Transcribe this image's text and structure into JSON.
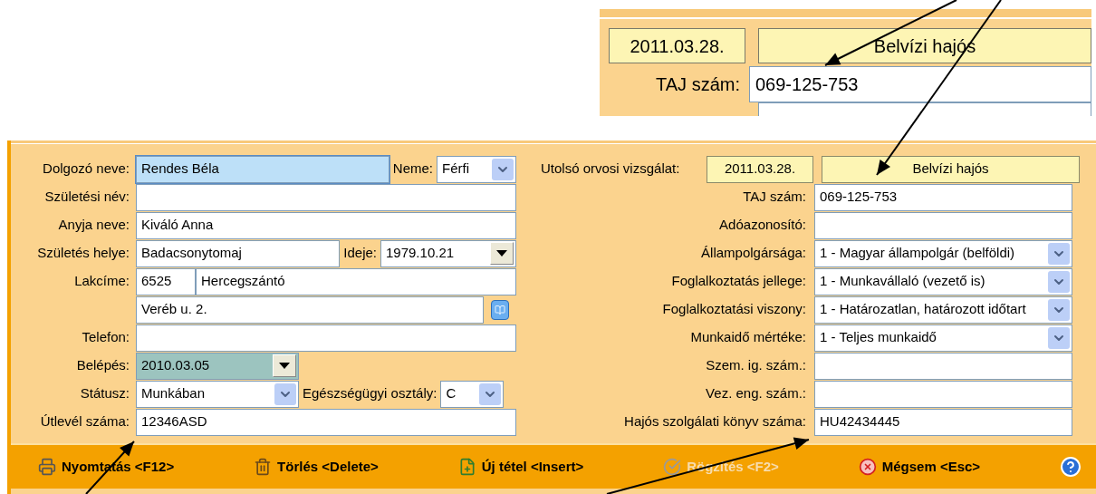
{
  "inset": {
    "date": "2011.03.28.",
    "category": "Belvízi hajós",
    "taj_label": "TAJ szám:",
    "taj_value": "069-125-753"
  },
  "left_rows": [
    {
      "label": "Dolgozó neve:",
      "fields": [
        {
          "kind": "text",
          "value": "Rendes Béla",
          "focused": true,
          "selected": false
        },
        {
          "kind": "select",
          "label": "Neme:",
          "value": "Férfi",
          "focused": false,
          "selected": false
        }
      ]
    },
    {
      "label": "Születési név:",
      "fields": [
        {
          "kind": "text",
          "focused": false,
          "selected": false
        }
      ]
    },
    {
      "label": "Anyja neve:",
      "fields": [
        {
          "kind": "text",
          "value": "Kiváló Anna",
          "focused": false,
          "selected": false
        }
      ]
    },
    {
      "label": "Születés helye:",
      "fields": [
        {
          "kind": "text",
          "value": "Badacsonytomaj",
          "focused": false,
          "selected": false
        },
        {
          "kind": "date",
          "label": "Ideje:",
          "value": "1979.10.21",
          "focused": false,
          "selected": false
        }
      ]
    },
    {
      "label": "Lakcíme:",
      "fields": [
        {
          "kind": "text",
          "value": "6525",
          "focused": false,
          "selected": false
        },
        {
          "kind": "text",
          "value": "Hercegszántó",
          "focused": false,
          "selected": false
        }
      ]
    },
    {
      "fields": [
        {
          "kind": "text",
          "value": "Veréb u. 2.",
          "focused": false,
          "selected": false
        },
        {
          "kind": "icon_button"
        }
      ]
    },
    {
      "label": "Telefon:",
      "fields": [
        {
          "kind": "text",
          "focused": false,
          "selected": false
        }
      ]
    },
    {
      "label": "Belépés:",
      "fields": [
        {
          "kind": "date",
          "value": "2010.03.05",
          "focused": false,
          "selected": true
        }
      ]
    },
    {
      "label": "Státusz:",
      "fields": [
        {
          "kind": "select",
          "value": "Munkában",
          "focused": false,
          "selected": false
        },
        {
          "kind": "select",
          "label": "Egészségügyi osztály:",
          "value": "C",
          "focused": false,
          "selected": false
        }
      ]
    },
    {
      "label": "Útlevél száma:",
      "fields": [
        {
          "kind": "text",
          "value": "12346ASD",
          "focused": false,
          "selected": false
        }
      ]
    }
  ],
  "right_rows": [
    {
      "label": "Utolsó orvosi vizsgálat:",
      "fields": [
        {
          "kind": "badge",
          "value": "2011.03.28."
        },
        {
          "kind": "badge",
          "value": "Belvízi hajós"
        }
      ]
    },
    {
      "label": "TAJ szám:",
      "fields": [
        {
          "kind": "text",
          "value": "069-125-753"
        }
      ]
    },
    {
      "label": "Adóazonosító:",
      "fields": [
        {
          "kind": "text"
        }
      ]
    },
    {
      "label": "Állampolgársága:",
      "fields": [
        {
          "kind": "select",
          "value": "1 - Magyar állampolgár (belföldi)"
        }
      ]
    },
    {
      "label": "Foglalkoztatás jellege:",
      "fields": [
        {
          "kind": "select",
          "value": "1 - Munkavállaló (vezető is)"
        }
      ]
    },
    {
      "label": "Foglalkoztatási viszony:",
      "fields": [
        {
          "kind": "select",
          "value": "1 - Határozatlan, határozott időtart"
        }
      ]
    },
    {
      "label": "Munkaidő mértéke:",
      "fields": [
        {
          "kind": "select",
          "value": "1 - Teljes munkaidő"
        }
      ]
    },
    {
      "label": "Szem. ig. szám.:",
      "fields": [
        {
          "kind": "text"
        }
      ]
    },
    {
      "label": "Vez. eng. szám.:",
      "fields": [
        {
          "kind": "text"
        }
      ]
    },
    {
      "label": "Hajós szolgálati könyv száma:",
      "fields": [
        {
          "kind": "text",
          "value": "HU42434445"
        }
      ]
    }
  ],
  "toolbar": [
    {
      "kind": "print",
      "label": "Nyomtatás <F12>",
      "disabled": false
    },
    {
      "kind": "delete",
      "label": "Törlés <Delete>",
      "disabled": false
    },
    {
      "kind": "new",
      "label": "Új tétel <Insert>",
      "disabled": false
    },
    {
      "kind": "save",
      "label": "Rögzítés <F2>",
      "disabled": true
    },
    {
      "kind": "cancel",
      "label": "Mégsem <Esc>",
      "disabled": false
    },
    {
      "kind": "help",
      "disabled": false
    }
  ]
}
